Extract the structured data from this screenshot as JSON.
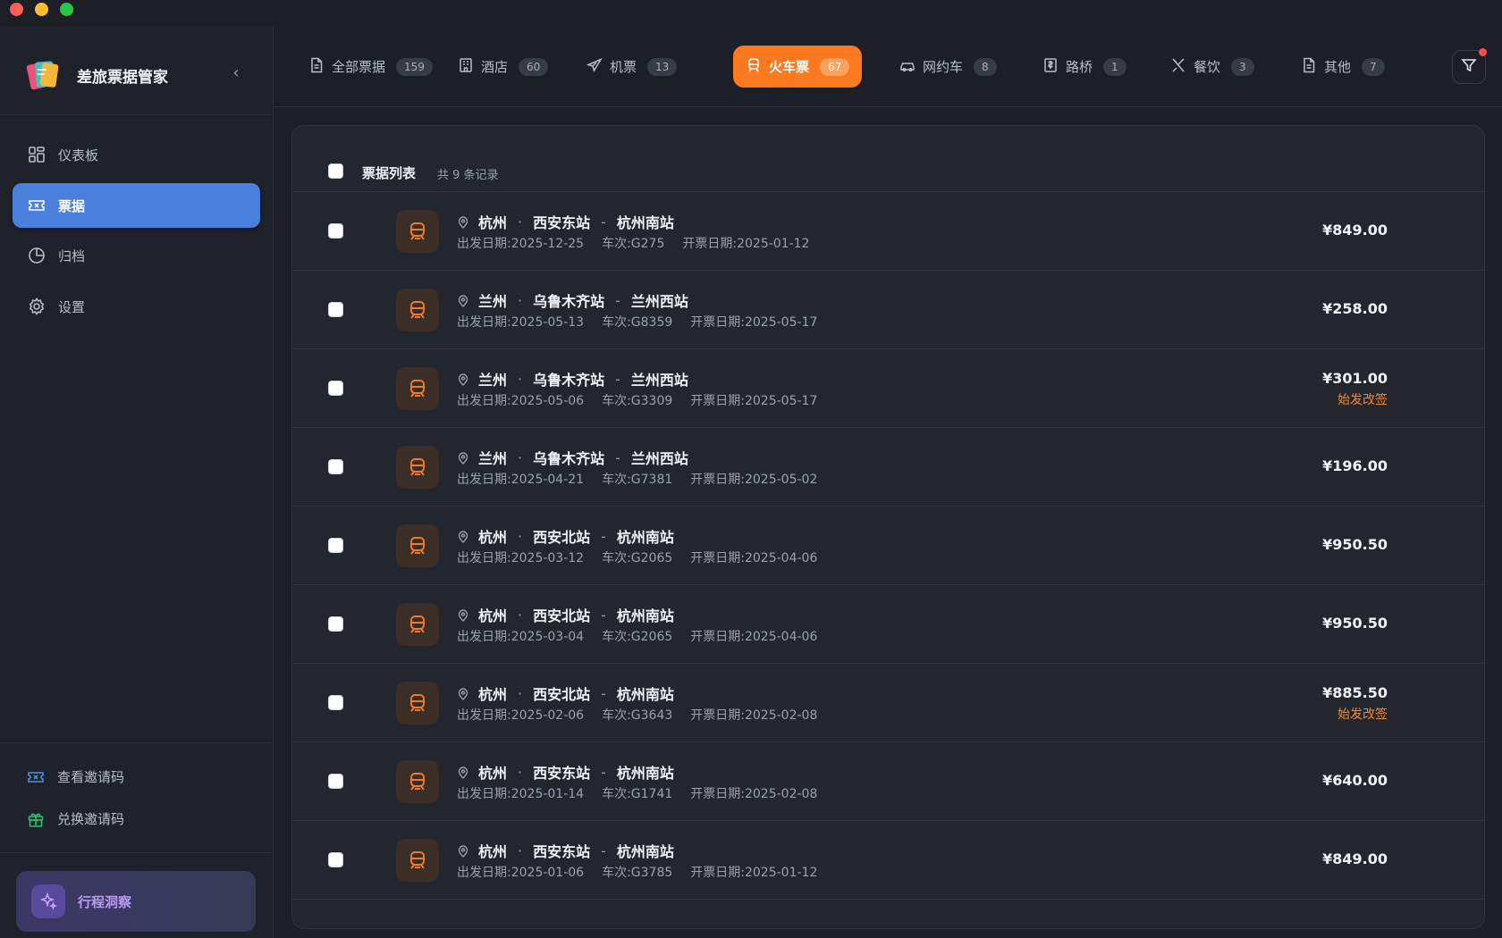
{
  "app": {
    "name": "差旅票据管家"
  },
  "sidebar": {
    "collapse_icon": "chevron-left-icon",
    "items": [
      {
        "label": "仪表板",
        "icon": "dashboard-icon",
        "active": false
      },
      {
        "label": "票据",
        "icon": "ticket-icon",
        "active": true
      },
      {
        "label": "归档",
        "icon": "pie-chart-icon",
        "active": false
      },
      {
        "label": "设置",
        "icon": "gear-icon",
        "active": false
      }
    ],
    "bottom_links": [
      {
        "label": "查看邀请码",
        "icon": "ticket-icon"
      },
      {
        "label": "兑换邀请码",
        "icon": "gift-icon"
      }
    ],
    "insight": {
      "label": "行程洞察",
      "icon": "sparkle-icon"
    }
  },
  "tabs": [
    {
      "label": "全部票据",
      "count": "159",
      "icon": "document-icon",
      "active": false
    },
    {
      "label": "酒店",
      "count": "60",
      "icon": "hotel-icon",
      "active": false
    },
    {
      "label": "机票",
      "count": "13",
      "icon": "plane-icon",
      "active": false
    },
    {
      "label": "火车票",
      "count": "67",
      "icon": "train-icon",
      "active": true
    },
    {
      "label": "网约车",
      "count": "8",
      "icon": "car-icon",
      "active": false
    },
    {
      "label": "路桥",
      "count": "1",
      "icon": "toll-receipt-icon",
      "active": false
    },
    {
      "label": "餐饮",
      "count": "3",
      "icon": "utensils-icon",
      "active": false
    },
    {
      "label": "其他",
      "count": "7",
      "icon": "document-icon",
      "active": false
    }
  ],
  "filter": {
    "icon": "filter-icon",
    "has_badge": true
  },
  "list": {
    "title": "票据列表",
    "count_text": "共 9 条记录",
    "rows": [
      {
        "city": "杭州",
        "from": "西安东站",
        "to": "杭州南站",
        "depart": "出发日期:2025-12-25",
        "train": "车次:G275",
        "issue": "开票日期:2025-01-12",
        "price": "¥849.00",
        "tag": ""
      },
      {
        "city": "兰州",
        "from": "乌鲁木齐站",
        "to": "兰州西站",
        "depart": "出发日期:2025-05-13",
        "train": "车次:G8359",
        "issue": "开票日期:2025-05-17",
        "price": "¥258.00",
        "tag": ""
      },
      {
        "city": "兰州",
        "from": "乌鲁木齐站",
        "to": "兰州西站",
        "depart": "出发日期:2025-05-06",
        "train": "车次:G3309",
        "issue": "开票日期:2025-05-17",
        "price": "¥301.00",
        "tag": "始发改签"
      },
      {
        "city": "兰州",
        "from": "乌鲁木齐站",
        "to": "兰州西站",
        "depart": "出发日期:2025-04-21",
        "train": "车次:G7381",
        "issue": "开票日期:2025-05-02",
        "price": "¥196.00",
        "tag": ""
      },
      {
        "city": "杭州",
        "from": "西安北站",
        "to": "杭州南站",
        "depart": "出发日期:2025-03-12",
        "train": "车次:G2065",
        "issue": "开票日期:2025-04-06",
        "price": "¥950.50",
        "tag": ""
      },
      {
        "city": "杭州",
        "from": "西安北站",
        "to": "杭州南站",
        "depart": "出发日期:2025-03-04",
        "train": "车次:G2065",
        "issue": "开票日期:2025-04-06",
        "price": "¥950.50",
        "tag": ""
      },
      {
        "city": "杭州",
        "from": "西安北站",
        "to": "杭州南站",
        "depart": "出发日期:2025-02-06",
        "train": "车次:G3643",
        "issue": "开票日期:2025-02-08",
        "price": "¥885.50",
        "tag": "始发改签"
      },
      {
        "city": "杭州",
        "from": "西安东站",
        "to": "杭州南站",
        "depart": "出发日期:2025-01-14",
        "train": "车次:G1741",
        "issue": "开票日期:2025-02-08",
        "price": "¥640.00",
        "tag": ""
      },
      {
        "city": "杭州",
        "from": "西安东站",
        "to": "杭州南站",
        "depart": "出发日期:2025-01-06",
        "train": "车次:G3785",
        "issue": "开票日期:2025-01-12",
        "price": "¥849.00",
        "tag": ""
      }
    ]
  },
  "colors": {
    "accent_orange": "#fb7a1f",
    "nav_active_blue": "#4a7fdb",
    "tag_orange": "#f08a32",
    "insight_purple": "#b89cf5"
  }
}
